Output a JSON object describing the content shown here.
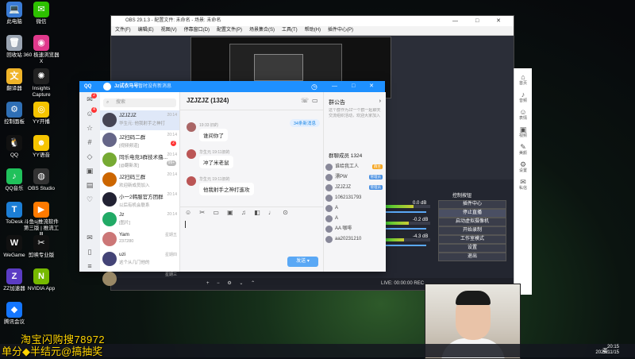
{
  "desktop": {
    "icons": [
      {
        "label": "此电脑",
        "glyph": "💻",
        "color": "#3a7bd5"
      },
      {
        "label": "微信",
        "glyph": "✉",
        "color": "#2dc100"
      },
      {
        "label": "回收站",
        "glyph": "🗑",
        "color": "#9aa4b2"
      },
      {
        "label": "360 极速浏览器X",
        "glyph": "◉",
        "color": "#e0398c"
      },
      {
        "label": "翻译器",
        "glyph": "文",
        "color": "#f0b429"
      },
      {
        "label": "Insights Capture",
        "glyph": "✺",
        "color": "#222"
      },
      {
        "label": "控制面板",
        "glyph": "⚙",
        "color": "#2f6fb5"
      },
      {
        "label": "YY开播",
        "glyph": "◎",
        "color": "#f5c400"
      },
      {
        "label": "QQ",
        "glyph": "🐧",
        "color": "#111"
      },
      {
        "label": "YY语音",
        "glyph": "☻",
        "color": "#f5c400"
      },
      {
        "label": "QQ音乐",
        "glyph": "♪",
        "color": "#20c15b"
      },
      {
        "label": "OBS Studio",
        "glyph": "◍",
        "color": "#333"
      },
      {
        "label": "ToDesk",
        "glyph": "T",
        "color": "#1c7ed6"
      },
      {
        "label": "斗鱼sj推流软件 第三版 | 推流工具",
        "glyph": "▶",
        "color": "#ff7a00"
      },
      {
        "label": "WeGame",
        "glyph": "W",
        "color": "#111"
      },
      {
        "label": "剪映专业版",
        "glyph": "✂",
        "color": "#111"
      },
      {
        "label": "ZZ加速器",
        "glyph": "Z",
        "color": "#5b3cc4"
      },
      {
        "label": "NVIDIA App",
        "glyph": "N",
        "color": "#76b900"
      },
      {
        "label": "腾讯会议",
        "glyph": "◆",
        "color": "#1476ff"
      }
    ]
  },
  "obs": {
    "title": "OBS 29.1.3 - 配置文件: 未命名 - 场景: 未命名",
    "window_controls": "— □ ✕",
    "menu": [
      "文件(F)",
      "编辑(E)",
      "视图(V)",
      "停靠窗口(D)",
      "配置文件(P)",
      "场景集合(S)",
      "工具(T)",
      "帮助(H)",
      "插件中心(P)"
    ],
    "mixer": [
      {
        "db": "0.0 dB",
        "level": 0.65
      },
      {
        "db": "-0.2 dB",
        "level": 0.55
      },
      {
        "db": "-4.3 dB",
        "level": 0.45
      }
    ],
    "controls_title": "控制按钮",
    "controls": [
      "插件中心",
      "停止直播",
      "启动虚拟摄像机",
      "开始录制",
      "工作室模式",
      "设置",
      "退出"
    ],
    "status": "LIVE: 00:00:00   REC"
  },
  "right_panel": {
    "items": [
      {
        "glyph": "⌂",
        "label": "首页"
      },
      {
        "glyph": "♪",
        "label": "音频"
      },
      {
        "glyph": "☺",
        "label": "表情"
      },
      {
        "glyph": "▣",
        "label": "视频"
      },
      {
        "glyph": "✎",
        "label": "美颜"
      },
      {
        "glyph": "⚙",
        "label": "设置"
      },
      {
        "glyph": "✉",
        "label": "私信"
      }
    ]
  },
  "qq": {
    "brand": "QQ",
    "user": "Jz试衣马号",
    "status": "暂时没有新消息",
    "window_controls": "— □ ✕",
    "search_placeholder": "搜索",
    "plus": "+",
    "nav_badges": [
      "2",
      "4"
    ],
    "conversations": [
      {
        "name": "JZJZJZ",
        "preview": "华生元: 他我射手之神打",
        "time": "20:14",
        "color": "#445",
        "selected": true
      },
      {
        "name": "JZ扫码二群",
        "preview": "[视频频道]",
        "time": "20:14",
        "color": "#668",
        "badge": "2"
      },
      {
        "name": "同乐电竞3群技术撸...",
        "preview": "[@翻新发]",
        "time": "20:14",
        "color": "#7a3",
        "badge": "99+"
      },
      {
        "name": "JZ扫码三群",
        "preview": "欢迎新成员加入",
        "time": "20:14",
        "color": "#c60"
      },
      {
        "name": "小一2韩服官方团群",
        "preview": "以后有机会联系",
        "time": "20:14",
        "color": "#223"
      },
      {
        "name": "Jz",
        "preview": "[图片]",
        "time": "20:14",
        "color": "#2a6"
      },
      {
        "name": "Yam",
        "preview": "237280",
        "time": "星期五",
        "color": "#c77"
      },
      {
        "name": "uzi",
        "preview": "这个从几门他的",
        "time": "星期四",
        "color": "#447"
      },
      {
        "name": "o",
        "preview": "",
        "time": "星期三",
        "color": "#986"
      }
    ],
    "chat": {
      "title": "JZJZJZ (1324)",
      "header_icons": [
        "☏",
        "▭",
        "▣",
        "⊕",
        "⊕",
        "⋯"
      ],
      "new_messages": "34条新消息",
      "messages": [
        {
          "who": "19:33  旧的",
          "text": "谁间你了",
          "color": "#a66"
        },
        {
          "who": "华生元  19:11旧的",
          "text": "冲了米老鼠",
          "color": "#b55"
        },
        {
          "who": "华生元  19:11旧的",
          "text": "他我射手之神打進攻",
          "color": "#b55"
        }
      ],
      "tools": "☺ ✂ ▭ ▣ ♫ ◧ ♩ ⊙",
      "send": "发送 ▾"
    },
    "group": {
      "announcement": "群公告",
      "announcement_text": "这个群作为JZ一个群一起聊天交流组织活动，欢迎大家加入",
      "members_title": "群聊成员 1324",
      "members": [
        {
          "name": "谁给我工人",
          "tag": "群主"
        },
        {
          "name": "漂PW",
          "tag": "管理员"
        },
        {
          "name": "JZJZJZ",
          "tag": "管理员"
        },
        {
          "name": "1062131793",
          "tag": ""
        },
        {
          "name": "A",
          "tag": ""
        },
        {
          "name": "A",
          "tag": ""
        },
        {
          "name": "AA 咖啡",
          "tag": ""
        },
        {
          "name": "aa20231210",
          "tag": ""
        }
      ]
    }
  },
  "overlay": {
    "taobao": "淘宝闪购搜78972",
    "lottery": "单分◆半结元@搞抽奖"
  },
  "taskbar": {
    "ime": "英",
    "time": "20:15",
    "date": "2025/11/15"
  }
}
